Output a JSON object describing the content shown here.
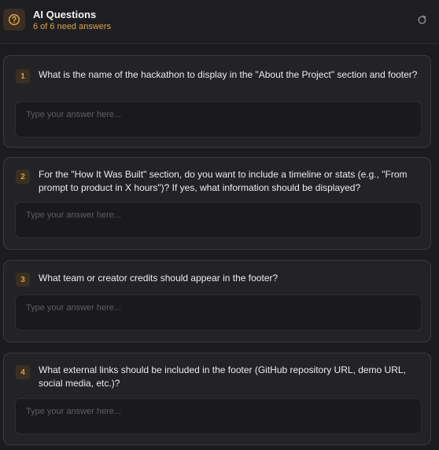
{
  "header": {
    "title": "AI Questions",
    "subtitle": "6 of 6 need answers",
    "icon": "question-circle-icon",
    "refresh_icon": "refresh-icon",
    "accent": "#d9a24a"
  },
  "questions": [
    {
      "number": "1",
      "text": "What is the name of the hackathon to display in the \"About the Project\" section and footer?",
      "placeholder": "Type your answer here...",
      "value": ""
    },
    {
      "number": "2",
      "text": "For the \"How It Was Built\" section, do you want to include a timeline or stats (e.g., \"From prompt to product in X hours\")? If yes, what information should be displayed?",
      "placeholder": "Type your answer here...",
      "value": ""
    },
    {
      "number": "3",
      "text": "What team or creator credits should appear in the footer?",
      "placeholder": "Type your answer here...",
      "value": ""
    },
    {
      "number": "4",
      "text": "What external links should be included in the footer (GitHub repository URL, demo URL, social media, etc.)?",
      "placeholder": "Type your answer here...",
      "value": ""
    }
  ]
}
